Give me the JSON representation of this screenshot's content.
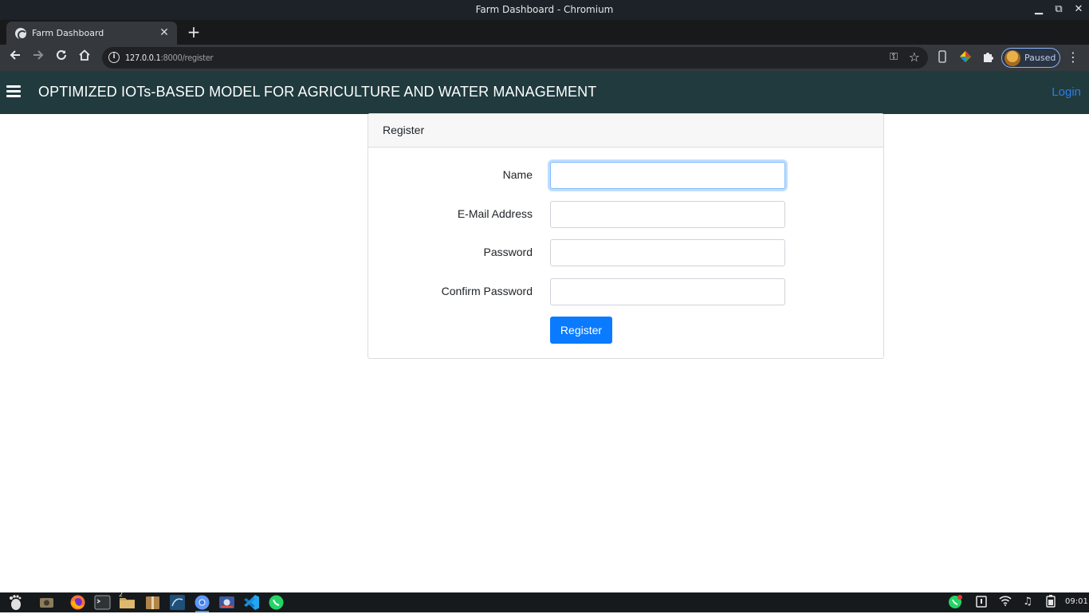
{
  "window": {
    "title": "Farm Dashboard - Chromium",
    "minimize_glyph": "▁",
    "maximize_glyph": "⧉",
    "close_glyph": "✕"
  },
  "browser": {
    "tab_title": "Farm Dashboard",
    "tab_close_glyph": "✕",
    "new_tab_glyph": "+",
    "url_host": "127.0.0.1",
    "url_rest": ":8000/register",
    "profile_label": "Paused",
    "icons": [
      "back-arrow-icon",
      "forward-arrow-icon",
      "reload-icon",
      "home-icon",
      "site-info-icon",
      "key-icon",
      "star-icon",
      "device-icon",
      "color-extension-icon",
      "puzzle-extension-icon",
      "menu-dots-icon"
    ]
  },
  "navbar": {
    "brand": "OPTIMIZED IOTs-BASED MODEL FOR AGRICULTURE AND WATER MANAGEMENT",
    "login": "Login",
    "background": "#203a3e",
    "link_color": "#2b7de9"
  },
  "form": {
    "header": "Register",
    "fields": [
      {
        "label": "Name",
        "value": "",
        "focused": true
      },
      {
        "label": "E-Mail Address",
        "value": ""
      },
      {
        "label": "Password",
        "value": ""
      },
      {
        "label": "Confirm Password",
        "value": ""
      }
    ],
    "submit": "Register",
    "accent": "#0a7bff"
  },
  "taskbar": {
    "apps": [
      "gnome-foot-icon",
      "camera-app-icon",
      "firefox-icon",
      "terminal-icon",
      "files-icon",
      "archive-manager-icon",
      "mysql-workbench-icon",
      "chromium-icon",
      "screenshot-tool-icon",
      "vscode-icon",
      "whatsapp-icon"
    ],
    "files_badge": "2",
    "tray": [
      "whatsapp-tray-icon",
      "clipboard-icon",
      "wifi-icon",
      "music-icon",
      "battery-icon"
    ],
    "clock": "09:01"
  }
}
